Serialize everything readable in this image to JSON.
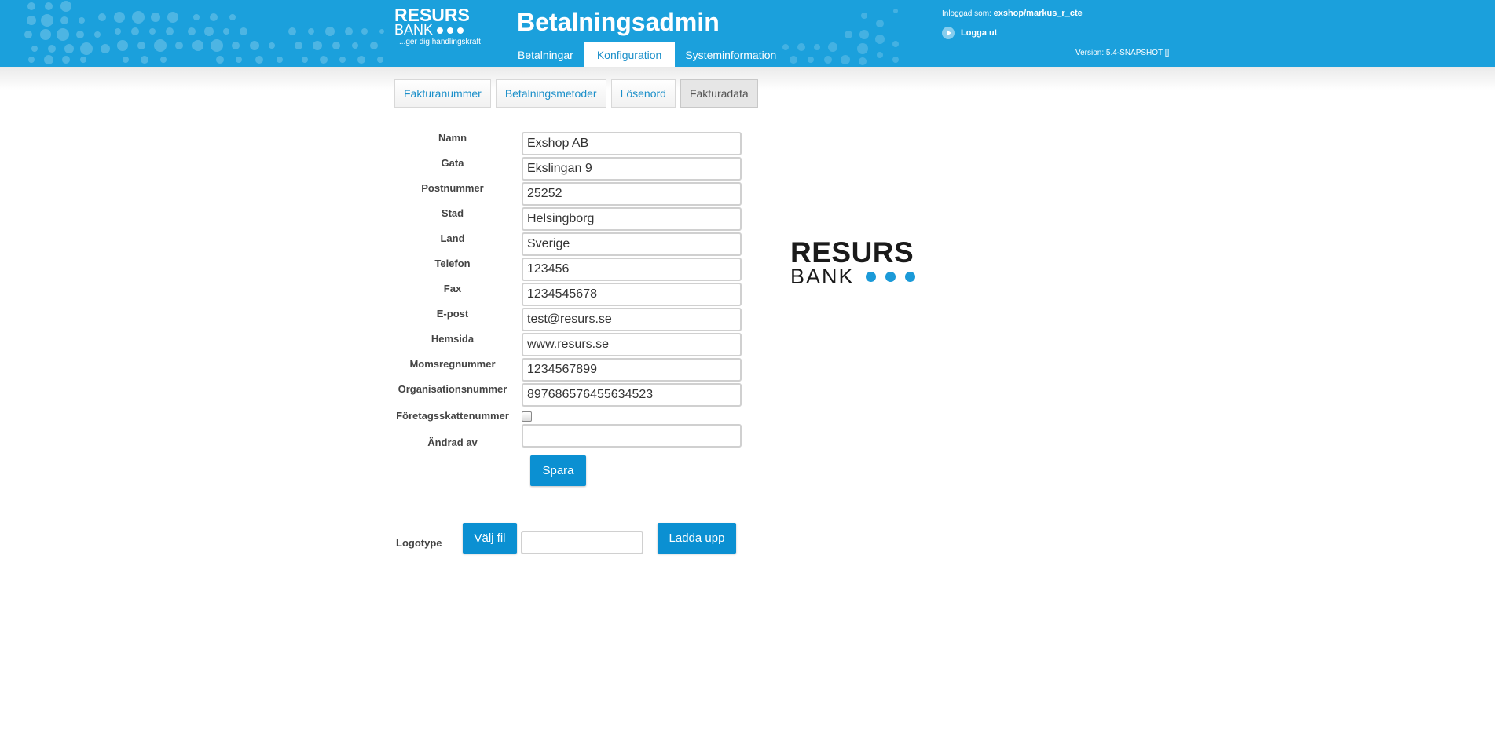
{
  "brand": {
    "logo_line1": "RESURS",
    "logo_line2": "BANK",
    "tagline": "...ger dig handlingskraft"
  },
  "header": {
    "app_title": "Betalningsadmin",
    "main_tabs": [
      {
        "label": "Betalningar",
        "active": false
      },
      {
        "label": "Konfiguration",
        "active": true
      },
      {
        "label": "Systeminformation",
        "active": false
      }
    ],
    "logged_in_prefix": "Inloggad som:",
    "logged_in_user": "exshop/markus_r_cte",
    "logout_label": "Logga ut",
    "version": "Version: 5.4-SNAPSHOT []"
  },
  "sub_tabs": [
    {
      "label": "Fakturanummer",
      "active": false
    },
    {
      "label": "Betalningsmetoder",
      "active": false
    },
    {
      "label": "Lösenord",
      "active": false
    },
    {
      "label": "Fakturadata",
      "active": true
    }
  ],
  "form": {
    "fields": [
      {
        "label": "Namn",
        "value": "Exshop AB"
      },
      {
        "label": "Gata",
        "value": "Ekslingan 9"
      },
      {
        "label": "Postnummer",
        "value": "25252"
      },
      {
        "label": "Stad",
        "value": "Helsingborg"
      },
      {
        "label": "Land",
        "value": "Sverige"
      },
      {
        "label": "Telefon",
        "value": "123456"
      },
      {
        "label": "Fax",
        "value": "1234545678"
      },
      {
        "label": "E-post",
        "value": "test@resurs.se"
      },
      {
        "label": "Hemsida",
        "value": "www.resurs.se"
      },
      {
        "label": "Momsregnummer",
        "value": "1234567899"
      },
      {
        "label": "Organisationsnummer",
        "value": "897686576455634523"
      }
    ],
    "company_tax_label": "Företagsskattenummer",
    "company_tax_checked": false,
    "changed_by_label": "Ändrad av",
    "changed_by_value": "",
    "save_label": "Spara"
  },
  "logotype": {
    "label": "Logotype",
    "choose_file_label": "Välj fil",
    "file_value": "",
    "upload_label": "Ladda upp",
    "preview_line1": "RESURS",
    "preview_line2": "BANK"
  },
  "colors": {
    "header_blue": "#1ba0dc",
    "button_blue": "#0b90d2",
    "link_blue": "#1b8fc9"
  }
}
